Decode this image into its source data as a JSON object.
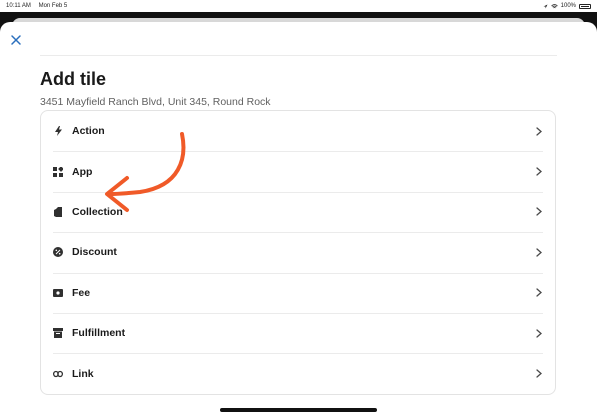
{
  "status_bar": {
    "time": "10:11 AM",
    "date": "Mon Feb 5",
    "battery": "100%"
  },
  "header": {
    "close_icon": "close-icon",
    "title": "Add tile",
    "subtitle": "3451 Mayfield Ranch Blvd, Unit 345, Round Rock"
  },
  "tiles": [
    {
      "label": "Action",
      "icon": "lightning-icon"
    },
    {
      "label": "App",
      "icon": "apps-grid-icon"
    },
    {
      "label": "Collection",
      "icon": "collection-tag-icon"
    },
    {
      "label": "Discount",
      "icon": "discount-icon"
    },
    {
      "label": "Fee",
      "icon": "cash-icon"
    },
    {
      "label": "Fulfillment",
      "icon": "fulfillment-icon"
    },
    {
      "label": "Link",
      "icon": "link-icon"
    }
  ],
  "colors": {
    "accent": "#2a6fbd",
    "annotation": "#f05a28"
  }
}
